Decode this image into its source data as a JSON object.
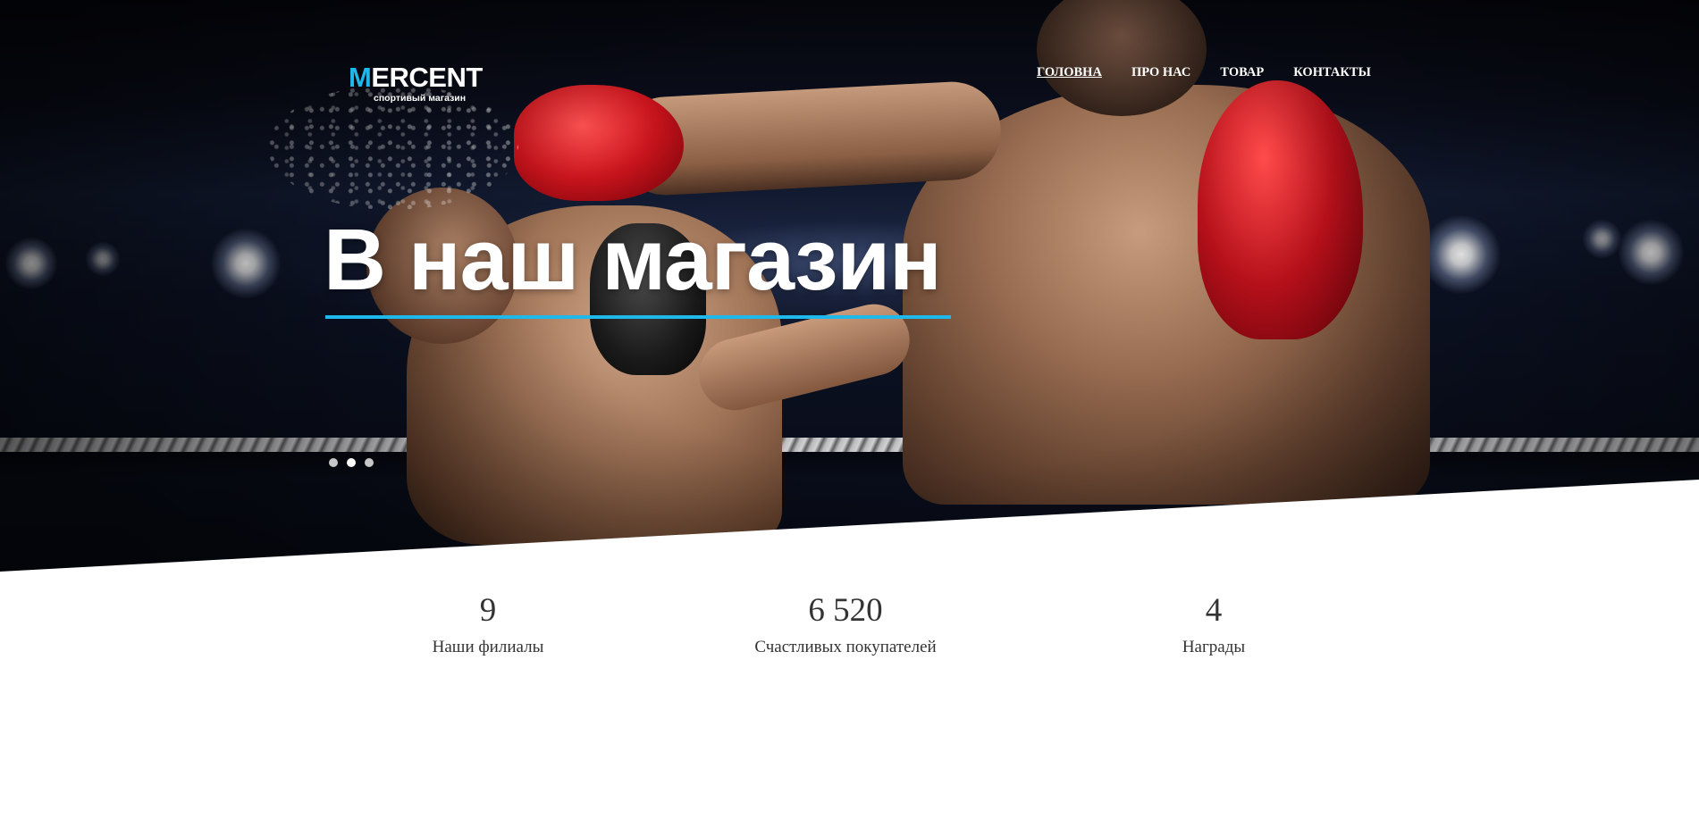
{
  "logo": {
    "initial": "M",
    "rest": "ERCENT",
    "tagline": "спортивый магазин"
  },
  "nav": {
    "items": [
      {
        "label": "ГОЛОВНА",
        "active": true
      },
      {
        "label": "ПРО НАС",
        "active": false
      },
      {
        "label": "ТОВАР",
        "active": false
      },
      {
        "label": "КОНТАКТЫ",
        "active": false
      }
    ]
  },
  "hero": {
    "title": "В наш магазин",
    "slides": {
      "count": 3,
      "active_index": 1
    }
  },
  "stats": [
    {
      "value": "9",
      "label": "Наши филиалы"
    },
    {
      "value": "6 520",
      "label": "Счастливых покупателей"
    },
    {
      "value": "4",
      "label": "Награды"
    }
  ],
  "colors": {
    "accent": "#1fb8ea",
    "text": "#333333",
    "nav_text": "#ffffff"
  }
}
